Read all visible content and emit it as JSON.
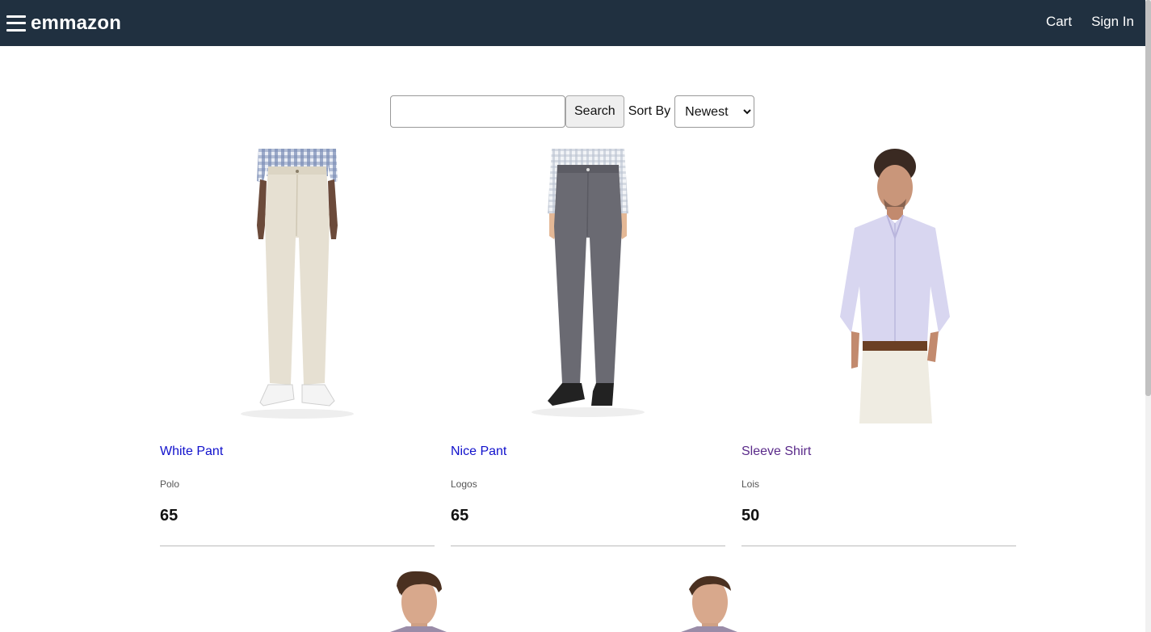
{
  "header": {
    "logo": "emmazon",
    "links": [
      "Cart",
      "Sign In"
    ]
  },
  "filter": {
    "search_value": "",
    "search_placeholder": "",
    "search_button": "Search",
    "sort_label": "Sort By",
    "sort_selected": "Newest"
  },
  "products": [
    {
      "name": "White Pant",
      "brand": "Polo",
      "price": "65"
    },
    {
      "name": "Nice Pant",
      "brand": "Logos",
      "price": "65"
    },
    {
      "name": "Sleeve Shirt",
      "brand": "Lois",
      "price": "50"
    }
  ],
  "colors": {
    "header_bg": "#203040",
    "link": "#1111cc",
    "visited_link": "#5a2a8a"
  }
}
